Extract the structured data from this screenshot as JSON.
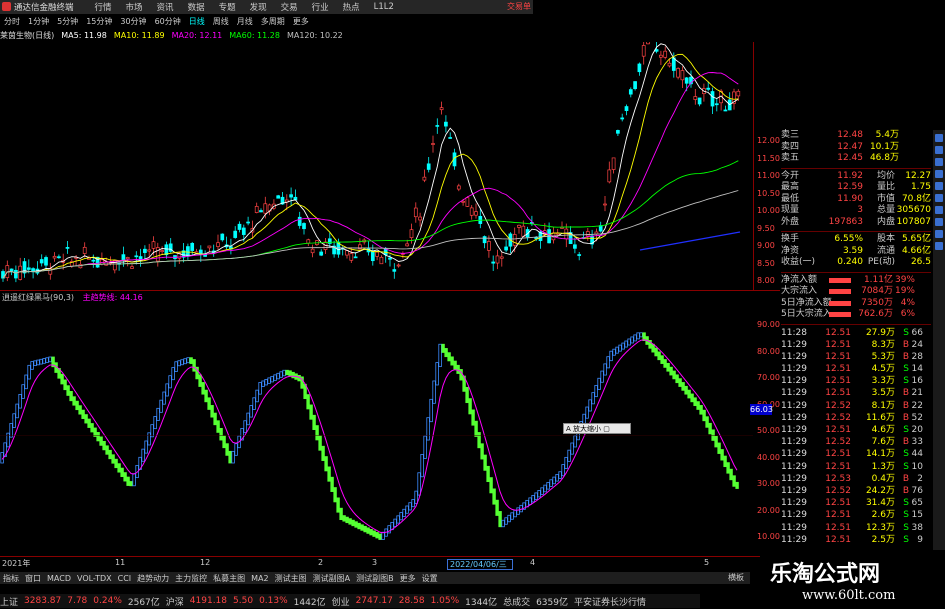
{
  "app": {
    "title": "通达信金融终端",
    "menu": [
      "行情",
      "市场",
      "资讯",
      "数据",
      "专题",
      "发现",
      "交易",
      "行业",
      "热点",
      "L1L2"
    ],
    "right_label": "交易单"
  },
  "periods": [
    "分时",
    "1分钟",
    "5分钟",
    "15分钟",
    "30分钟",
    "60分钟",
    "日线",
    "周线",
    "月线",
    "多周期",
    "更多"
  ],
  "active_period": "日线",
  "stock_ma": {
    "name": "莱茵生物(日线)",
    "items": [
      {
        "label": "MA5: 11.98",
        "color": "#ffffff"
      },
      {
        "label": "MA10: 11.89",
        "color": "#ffff00"
      },
      {
        "label": "MA20: 12.11",
        "color": "#ff00ff"
      },
      {
        "label": "MA60: 11.28",
        "color": "#00ff00"
      },
      {
        "label": "MA120: 10.22",
        "color": "#c0c0c0"
      }
    ]
  },
  "price_axis": [
    "12.00",
    "11.50",
    "11.00",
    "10.50",
    "10.00",
    "9.50",
    "9.00",
    "8.50",
    "8.00"
  ],
  "osc_axis": [
    "90.00",
    "80.00",
    "70.00",
    "60.00",
    "50.00",
    "40.00",
    "30.00",
    "20.00",
    "10.00"
  ],
  "indicator": {
    "name": "逍遥红绿黑马(90,3)",
    "sub": "主趋势线:",
    "value": "44.16",
    "current_tag": "66.03"
  },
  "date_labels": [
    "2021年",
    "11",
    "12",
    "2",
    "3",
    "4",
    "5"
  ],
  "cursor_date": "2022/04/06/三",
  "tooltip": "A 放大缩小 ▢",
  "quote": {
    "ask_levels": [
      {
        "label": "卖三",
        "price": "12.48",
        "vol": "5.4万"
      },
      {
        "label": "卖四",
        "price": "12.47",
        "vol": "10.1万"
      },
      {
        "label": "卖五",
        "price": "12.45",
        "vol": "46.8万"
      }
    ],
    "stats": [
      {
        "l": "今开",
        "v": "11.92",
        "l2": "均价",
        "v2": "12.27"
      },
      {
        "l": "最高",
        "v": "12.59",
        "l2": "量比",
        "v2": "1.75"
      },
      {
        "l": "最低",
        "v": "11.90",
        "l2": "市值",
        "v2": "70.8亿"
      },
      {
        "l": "现量",
        "v": "3",
        "l2": "总量",
        "v2": "305670"
      },
      {
        "l": "外盘",
        "v": "197863",
        "l2": "内盘",
        "v2": "107807"
      }
    ],
    "stats2": [
      {
        "l": "换手",
        "v": "6.55%",
        "l2": "股本",
        "v2": "5.65亿"
      },
      {
        "l": "净资",
        "v": "3.59",
        "l2": "流通",
        "v2": "4.66亿"
      },
      {
        "l": "收益(一)",
        "v": "0.240",
        "l2": "PE(动)",
        "v2": "26.5"
      }
    ],
    "flows": [
      {
        "l": "净流入额",
        "v": "1.11亿",
        "p": "39%"
      },
      {
        "l": "大宗流入",
        "v": "7084万",
        "p": "19%"
      },
      {
        "l": "5日净流入额",
        "v": "7350万",
        "p": "4%"
      },
      {
        "l": "5日大宗流入",
        "v": "762.6万",
        "p": "6%"
      }
    ]
  },
  "ticks": [
    {
      "t": "11:28",
      "p": "12.51",
      "v": "27.9万",
      "bs": "S",
      "n": "66"
    },
    {
      "t": "11:29",
      "p": "12.51",
      "v": "8.3万",
      "bs": "B",
      "n": "24"
    },
    {
      "t": "11:29",
      "p": "12.51",
      "v": "5.3万",
      "bs": "B",
      "n": "28"
    },
    {
      "t": "11:29",
      "p": "12.51",
      "v": "4.5万",
      "bs": "S",
      "n": "14"
    },
    {
      "t": "11:29",
      "p": "12.51",
      "v": "3.3万",
      "bs": "S",
      "n": "16"
    },
    {
      "t": "11:29",
      "p": "12.51",
      "v": "3.5万",
      "bs": "B",
      "n": "21"
    },
    {
      "t": "11:29",
      "p": "12.52",
      "v": "8.1万",
      "bs": "B",
      "n": "22"
    },
    {
      "t": "11:29",
      "p": "12.52",
      "v": "11.6万",
      "bs": "B",
      "n": "52"
    },
    {
      "t": "11:29",
      "p": "12.51",
      "v": "4.6万",
      "bs": "S",
      "n": "20"
    },
    {
      "t": "11:29",
      "p": "12.52",
      "v": "7.6万",
      "bs": "B",
      "n": "33"
    },
    {
      "t": "11:29",
      "p": "12.51",
      "v": "14.1万",
      "bs": "S",
      "n": "44"
    },
    {
      "t": "11:29",
      "p": "12.51",
      "v": "1.3万",
      "bs": "S",
      "n": "10"
    },
    {
      "t": "11:29",
      "p": "12.53",
      "v": "0.4万",
      "bs": "B",
      "n": "2"
    },
    {
      "t": "11:29",
      "p": "12.52",
      "v": "24.2万",
      "bs": "B",
      "n": "76"
    },
    {
      "t": "11:29",
      "p": "12.51",
      "v": "31.4万",
      "bs": "S",
      "n": "65"
    },
    {
      "t": "11:29",
      "p": "12.51",
      "v": "2.6万",
      "bs": "S",
      "n": "15"
    },
    {
      "t": "11:29",
      "p": "12.51",
      "v": "12.3万",
      "bs": "S",
      "n": "38"
    },
    {
      "t": "11:29",
      "p": "12.51",
      "v": "2.5万",
      "bs": "S",
      "n": "9"
    }
  ],
  "bottom_tabs": [
    "指标",
    "窗口",
    "MACD",
    "VOL-TDX",
    "CCI",
    "趋势动力",
    "主力监控",
    "私募主图",
    "MA2",
    "测试主图",
    "测试副图A",
    "测试副图B",
    "更多",
    "设置"
  ],
  "bottom_right": "横板",
  "status": {
    "items": [
      {
        "text": "上证",
        "color": "#ccc"
      },
      {
        "text": "3283.87",
        "color": "#f44"
      },
      {
        "text": "7.78",
        "color": "#f44"
      },
      {
        "text": "0.24%",
        "color": "#f44"
      },
      {
        "text": "2567亿",
        "color": "#ccc"
      },
      {
        "text": "沪深",
        "color": "#ccc"
      },
      {
        "text": "4191.18",
        "color": "#f44"
      },
      {
        "text": "5.50",
        "color": "#f44"
      },
      {
        "text": "0.13%",
        "color": "#f44"
      },
      {
        "text": "1442亿",
        "color": "#ccc"
      },
      {
        "text": "创业",
        "color": "#ccc"
      },
      {
        "text": "2747.17",
        "color": "#f44"
      },
      {
        "text": "28.58",
        "color": "#f44"
      },
      {
        "text": "1.05%",
        "color": "#f44"
      },
      {
        "text": "1344亿",
        "color": "#ccc"
      },
      {
        "text": "总成交",
        "color": "#ccc"
      },
      {
        "text": "6359亿",
        "color": "#ccc"
      },
      {
        "text": "平安证券长沙行情",
        "color": "#ccc"
      }
    ]
  },
  "watermark": {
    "title": "乐淘公式网",
    "url": "www.60lt.com"
  },
  "colors": {
    "up": "#ff4444",
    "down": "#00ffff",
    "osc_up": "#3c8cff",
    "osc_down": "#55ff33",
    "ma_line": "#ff00ff"
  }
}
